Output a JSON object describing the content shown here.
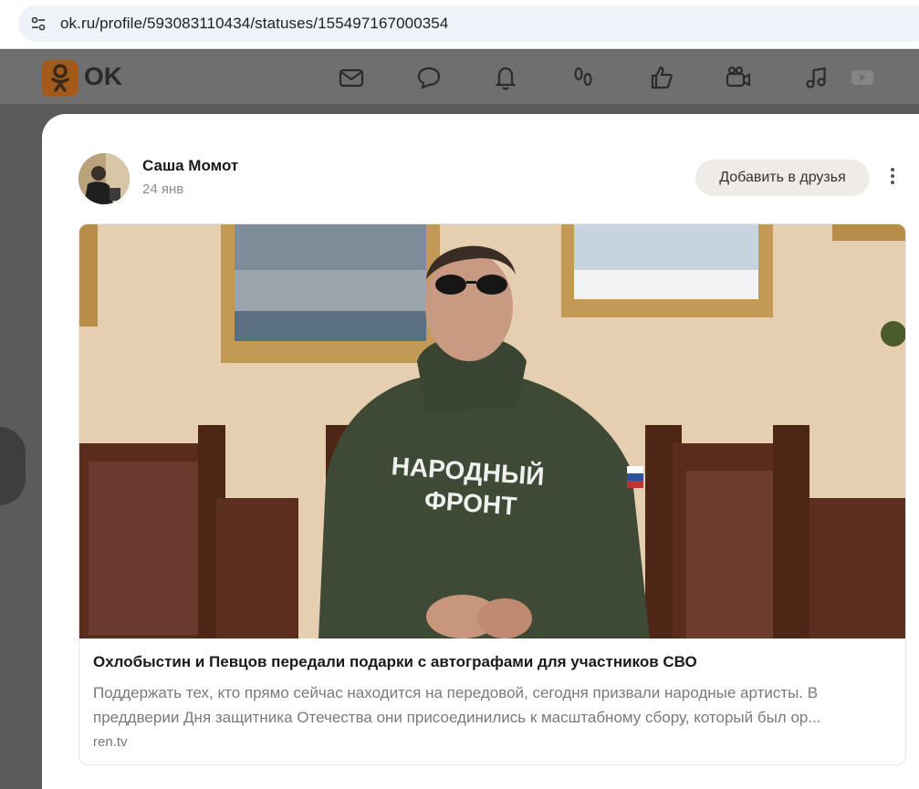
{
  "browser": {
    "url": "ok.ru/profile/593083110434/statuses/155497167000354"
  },
  "header": {
    "logo_text": "OK",
    "brand_color": "#ee8208",
    "nav_icons": [
      "messages-icon",
      "discussions-icon",
      "notifications-icon",
      "guests-icon",
      "events-icon",
      "video-icon",
      "music-icon",
      "live-icon"
    ]
  },
  "post": {
    "author": "Саша Момот",
    "date": "24 янв",
    "add_friend_label": "Добавить в друзья",
    "preview": {
      "video_caption": "НАРОДНЫЙ\nФРОНТ",
      "title": "Охлобыстин и Певцов передали подарки с автографами для участников СВО",
      "description": "Поддержать тех, кто прямо сейчас находится на передовой, сегодня призвали народные артисты. В преддверии Дня защитника Отечества они присоединились к масштабному сбору, который был ор...",
      "source": "ren.tv"
    }
  }
}
